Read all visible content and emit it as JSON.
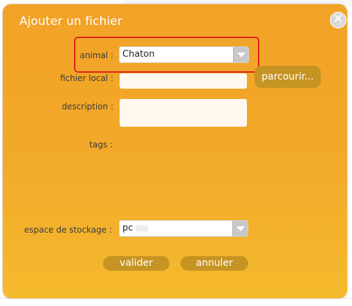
{
  "dialog": {
    "title": "Ajouter un fichier",
    "close_glyph": "✕"
  },
  "form": {
    "animal_label": "animal :",
    "animal_value": "Chaton",
    "fichier_local_label": "fichier local :",
    "description_label": "description :",
    "tags_label": "tags :",
    "espace_label": "espace de stockage :",
    "espace_value": "pc"
  },
  "buttons": {
    "parcourir": "parcourir...",
    "valider": "valider",
    "annuler": "annuler"
  },
  "colors": {
    "dialog_top": "#f2a227",
    "dialog_bottom": "#f5ba2d",
    "button": "#c69423",
    "highlight": "#e0201b"
  },
  "icons": {
    "close": "close-icon",
    "dropdown": "chevron-down-icon"
  }
}
